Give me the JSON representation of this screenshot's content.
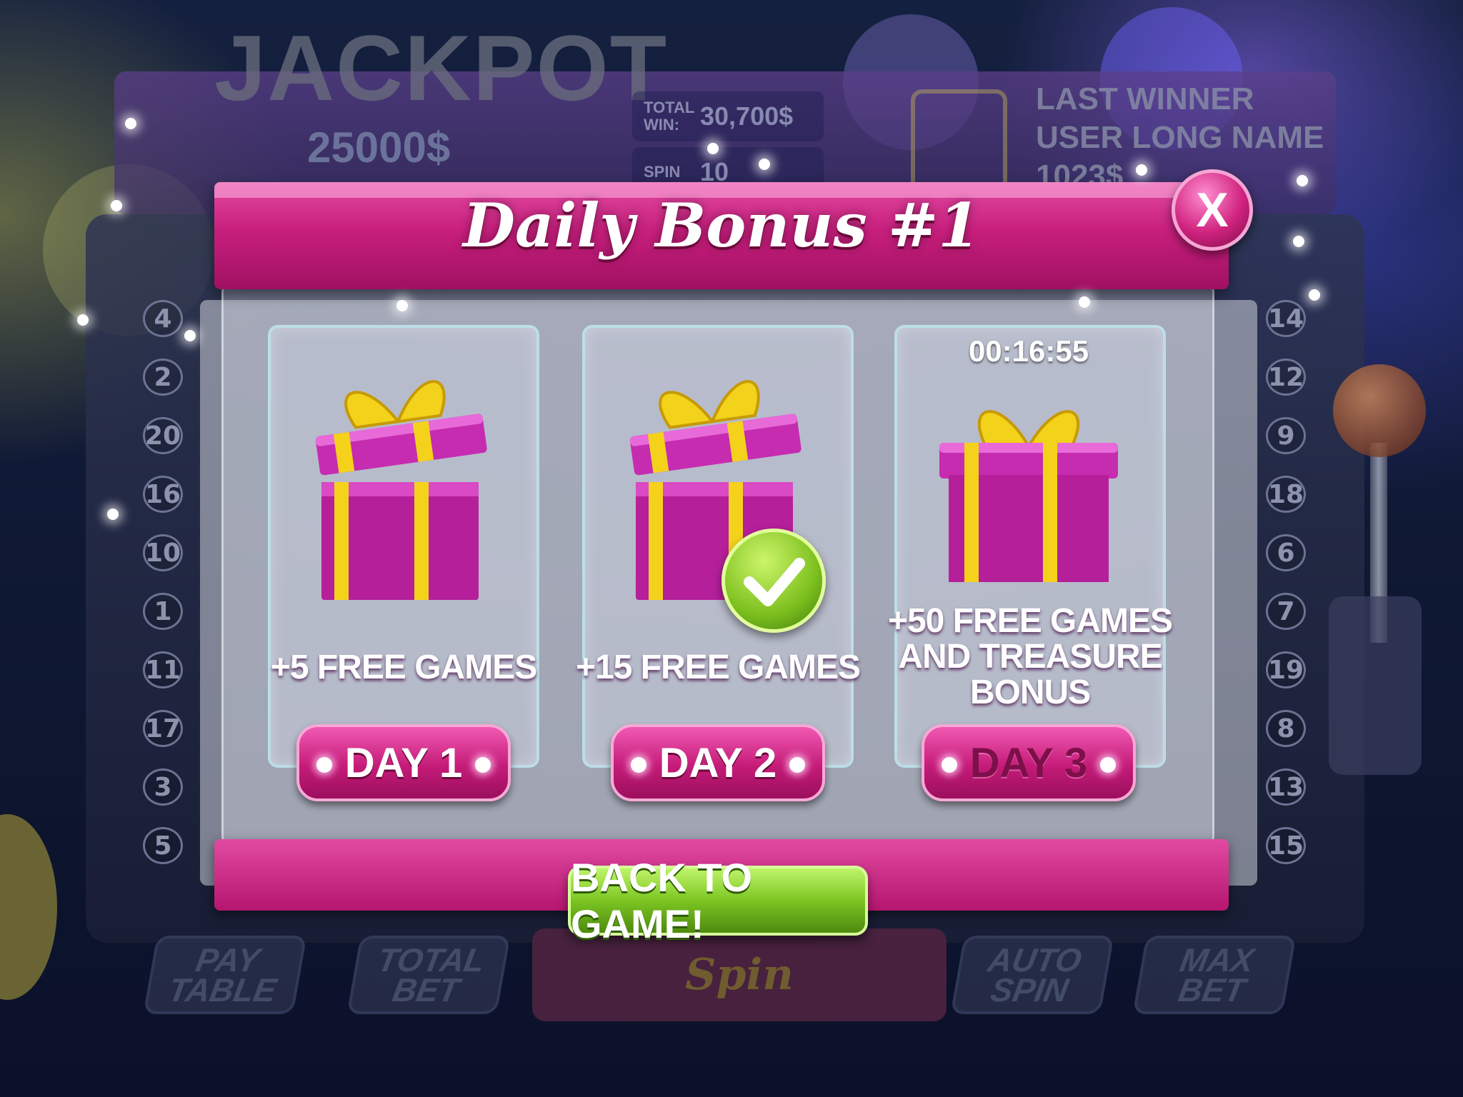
{
  "background": {
    "jackpot": {
      "title": "JACKPOT",
      "amount": "25000$"
    },
    "stats": [
      {
        "label": "TOTAL WIN:",
        "value": "30,700$"
      },
      {
        "label": "SPIN",
        "value": "10"
      }
    ],
    "last_winner": {
      "title": "LAST WINNER",
      "name": "USER LONG NAME",
      "amount": "1023$"
    },
    "left_numbers": [
      "4",
      "2",
      "20",
      "16",
      "10",
      "1",
      "11",
      "17",
      "3",
      "5"
    ],
    "right_numbers": [
      "14",
      "12",
      "9",
      "18",
      "6",
      "7",
      "19",
      "8",
      "13",
      "15"
    ],
    "bottom_buttons": [
      {
        "label": "PAY TABLE"
      },
      {
        "label": "TOTAL BET"
      },
      {
        "label": "AUTO SPIN"
      },
      {
        "label": "MAX BET"
      }
    ],
    "spin_label": "Spin"
  },
  "dialog": {
    "title": "Daily Bonus #1",
    "close_label": "X",
    "cards": [
      {
        "reward": "+5 FREE GAMES",
        "day_label": "DAY 1",
        "state": "open"
      },
      {
        "reward": "+15 FREE GAMES",
        "day_label": "DAY 2",
        "state": "claimed"
      },
      {
        "reward": "+50 FREE GAMES AND TREASURE BONUS",
        "day_label": "DAY 3",
        "state": "locked",
        "timer": "00:16:55"
      }
    ],
    "back_button": "BACK TO GAME!",
    "icons": {
      "gift": "gift-box-icon",
      "check": "checkmark-icon",
      "close": "close-icon"
    },
    "colors": {
      "primary_pink": "#c81f7d",
      "button_green": "#7cc622",
      "gift_purple": "#b51f9a",
      "ribbon_yellow": "#f4d21c"
    }
  }
}
